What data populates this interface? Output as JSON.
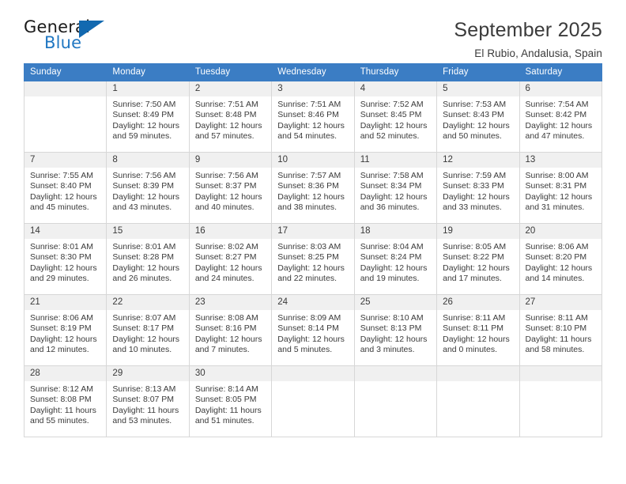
{
  "brand": {
    "name_top": "General",
    "name_bottom": "Blue",
    "triangle_color": "#1269b0",
    "blue_color": "#2077c2"
  },
  "header": {
    "title": "September 2025",
    "subtitle": "El Rubio, Andalusia, Spain"
  },
  "calendar": {
    "header_bg": "#3b7dc4",
    "daynum_bg": "#f0f0f0",
    "weekdays": [
      "Sunday",
      "Monday",
      "Tuesday",
      "Wednesday",
      "Thursday",
      "Friday",
      "Saturday"
    ],
    "weeks": [
      [
        {
          "day": "",
          "sunrise": "",
          "sunset": "",
          "daylight_1": "",
          "daylight_2": ""
        },
        {
          "day": "1",
          "sunrise": "Sunrise: 7:50 AM",
          "sunset": "Sunset: 8:49 PM",
          "daylight_1": "Daylight: 12 hours",
          "daylight_2": "and 59 minutes."
        },
        {
          "day": "2",
          "sunrise": "Sunrise: 7:51 AM",
          "sunset": "Sunset: 8:48 PM",
          "daylight_1": "Daylight: 12 hours",
          "daylight_2": "and 57 minutes."
        },
        {
          "day": "3",
          "sunrise": "Sunrise: 7:51 AM",
          "sunset": "Sunset: 8:46 PM",
          "daylight_1": "Daylight: 12 hours",
          "daylight_2": "and 54 minutes."
        },
        {
          "day": "4",
          "sunrise": "Sunrise: 7:52 AM",
          "sunset": "Sunset: 8:45 PM",
          "daylight_1": "Daylight: 12 hours",
          "daylight_2": "and 52 minutes."
        },
        {
          "day": "5",
          "sunrise": "Sunrise: 7:53 AM",
          "sunset": "Sunset: 8:43 PM",
          "daylight_1": "Daylight: 12 hours",
          "daylight_2": "and 50 minutes."
        },
        {
          "day": "6",
          "sunrise": "Sunrise: 7:54 AM",
          "sunset": "Sunset: 8:42 PM",
          "daylight_1": "Daylight: 12 hours",
          "daylight_2": "and 47 minutes."
        }
      ],
      [
        {
          "day": "7",
          "sunrise": "Sunrise: 7:55 AM",
          "sunset": "Sunset: 8:40 PM",
          "daylight_1": "Daylight: 12 hours",
          "daylight_2": "and 45 minutes."
        },
        {
          "day": "8",
          "sunrise": "Sunrise: 7:56 AM",
          "sunset": "Sunset: 8:39 PM",
          "daylight_1": "Daylight: 12 hours",
          "daylight_2": "and 43 minutes."
        },
        {
          "day": "9",
          "sunrise": "Sunrise: 7:56 AM",
          "sunset": "Sunset: 8:37 PM",
          "daylight_1": "Daylight: 12 hours",
          "daylight_2": "and 40 minutes."
        },
        {
          "day": "10",
          "sunrise": "Sunrise: 7:57 AM",
          "sunset": "Sunset: 8:36 PM",
          "daylight_1": "Daylight: 12 hours",
          "daylight_2": "and 38 minutes."
        },
        {
          "day": "11",
          "sunrise": "Sunrise: 7:58 AM",
          "sunset": "Sunset: 8:34 PM",
          "daylight_1": "Daylight: 12 hours",
          "daylight_2": "and 36 minutes."
        },
        {
          "day": "12",
          "sunrise": "Sunrise: 7:59 AM",
          "sunset": "Sunset: 8:33 PM",
          "daylight_1": "Daylight: 12 hours",
          "daylight_2": "and 33 minutes."
        },
        {
          "day": "13",
          "sunrise": "Sunrise: 8:00 AM",
          "sunset": "Sunset: 8:31 PM",
          "daylight_1": "Daylight: 12 hours",
          "daylight_2": "and 31 minutes."
        }
      ],
      [
        {
          "day": "14",
          "sunrise": "Sunrise: 8:01 AM",
          "sunset": "Sunset: 8:30 PM",
          "daylight_1": "Daylight: 12 hours",
          "daylight_2": "and 29 minutes."
        },
        {
          "day": "15",
          "sunrise": "Sunrise: 8:01 AM",
          "sunset": "Sunset: 8:28 PM",
          "daylight_1": "Daylight: 12 hours",
          "daylight_2": "and 26 minutes."
        },
        {
          "day": "16",
          "sunrise": "Sunrise: 8:02 AM",
          "sunset": "Sunset: 8:27 PM",
          "daylight_1": "Daylight: 12 hours",
          "daylight_2": "and 24 minutes."
        },
        {
          "day": "17",
          "sunrise": "Sunrise: 8:03 AM",
          "sunset": "Sunset: 8:25 PM",
          "daylight_1": "Daylight: 12 hours",
          "daylight_2": "and 22 minutes."
        },
        {
          "day": "18",
          "sunrise": "Sunrise: 8:04 AM",
          "sunset": "Sunset: 8:24 PM",
          "daylight_1": "Daylight: 12 hours",
          "daylight_2": "and 19 minutes."
        },
        {
          "day": "19",
          "sunrise": "Sunrise: 8:05 AM",
          "sunset": "Sunset: 8:22 PM",
          "daylight_1": "Daylight: 12 hours",
          "daylight_2": "and 17 minutes."
        },
        {
          "day": "20",
          "sunrise": "Sunrise: 8:06 AM",
          "sunset": "Sunset: 8:20 PM",
          "daylight_1": "Daylight: 12 hours",
          "daylight_2": "and 14 minutes."
        }
      ],
      [
        {
          "day": "21",
          "sunrise": "Sunrise: 8:06 AM",
          "sunset": "Sunset: 8:19 PM",
          "daylight_1": "Daylight: 12 hours",
          "daylight_2": "and 12 minutes."
        },
        {
          "day": "22",
          "sunrise": "Sunrise: 8:07 AM",
          "sunset": "Sunset: 8:17 PM",
          "daylight_1": "Daylight: 12 hours",
          "daylight_2": "and 10 minutes."
        },
        {
          "day": "23",
          "sunrise": "Sunrise: 8:08 AM",
          "sunset": "Sunset: 8:16 PM",
          "daylight_1": "Daylight: 12 hours",
          "daylight_2": "and 7 minutes."
        },
        {
          "day": "24",
          "sunrise": "Sunrise: 8:09 AM",
          "sunset": "Sunset: 8:14 PM",
          "daylight_1": "Daylight: 12 hours",
          "daylight_2": "and 5 minutes."
        },
        {
          "day": "25",
          "sunrise": "Sunrise: 8:10 AM",
          "sunset": "Sunset: 8:13 PM",
          "daylight_1": "Daylight: 12 hours",
          "daylight_2": "and 3 minutes."
        },
        {
          "day": "26",
          "sunrise": "Sunrise: 8:11 AM",
          "sunset": "Sunset: 8:11 PM",
          "daylight_1": "Daylight: 12 hours",
          "daylight_2": "and 0 minutes."
        },
        {
          "day": "27",
          "sunrise": "Sunrise: 8:11 AM",
          "sunset": "Sunset: 8:10 PM",
          "daylight_1": "Daylight: 11 hours",
          "daylight_2": "and 58 minutes."
        }
      ],
      [
        {
          "day": "28",
          "sunrise": "Sunrise: 8:12 AM",
          "sunset": "Sunset: 8:08 PM",
          "daylight_1": "Daylight: 11 hours",
          "daylight_2": "and 55 minutes."
        },
        {
          "day": "29",
          "sunrise": "Sunrise: 8:13 AM",
          "sunset": "Sunset: 8:07 PM",
          "daylight_1": "Daylight: 11 hours",
          "daylight_2": "and 53 minutes."
        },
        {
          "day": "30",
          "sunrise": "Sunrise: 8:14 AM",
          "sunset": "Sunset: 8:05 PM",
          "daylight_1": "Daylight: 11 hours",
          "daylight_2": "and 51 minutes."
        },
        {
          "day": "",
          "sunrise": "",
          "sunset": "",
          "daylight_1": "",
          "daylight_2": ""
        },
        {
          "day": "",
          "sunrise": "",
          "sunset": "",
          "daylight_1": "",
          "daylight_2": ""
        },
        {
          "day": "",
          "sunrise": "",
          "sunset": "",
          "daylight_1": "",
          "daylight_2": ""
        },
        {
          "day": "",
          "sunrise": "",
          "sunset": "",
          "daylight_1": "",
          "daylight_2": ""
        }
      ]
    ]
  }
}
